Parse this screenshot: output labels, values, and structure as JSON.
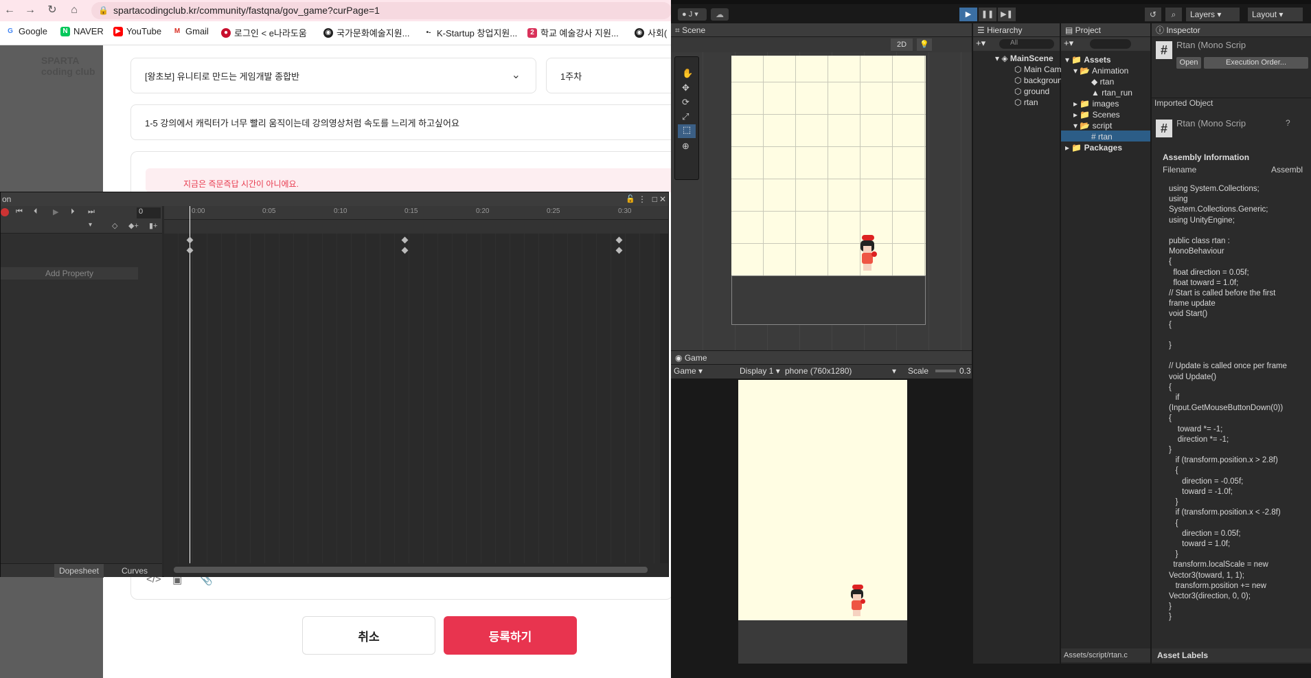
{
  "browser": {
    "url": "spartacodingclub.kr/community/fastqna/gov_game?curPage=1",
    "bookmarks": [
      "Google",
      "NAVER",
      "YouTube",
      "Gmail",
      "로그인 < e나라도움",
      "국가문화예술지원...",
      "K-Startup 창업지원...",
      "학교 예술강사 지원...",
      "사회("
    ]
  },
  "page": {
    "logo": "SPARTA coding club",
    "course_select": "[왕초보] 유니티로 만드는 게임개발 종합반",
    "week_select": "1주차",
    "question_title": "1-5 강의에서 캐릭터가 너무 빨리 움직이는데 강의영상처럼 속도를 느리게 하고싶어요",
    "warning": "지금은 즉문즉답 시간이 아니에요.",
    "cancel_label": "취소",
    "submit_label": "등록하기"
  },
  "animation": {
    "title": "on",
    "frame_value": "0",
    "add_property": "Add Property",
    "ticks": [
      "0:00",
      "0:05",
      "0:10",
      "0:15",
      "0:20",
      "0:25",
      "0:30"
    ],
    "tab_dopesheet": "Dopesheet",
    "tab_curves": "Curves"
  },
  "unity": {
    "account": "J",
    "layers": "Layers",
    "layout": "Layout",
    "scene_tab": "Scene",
    "mode_2d": "2D",
    "game_tab": "Game",
    "game_dropdown": "Game",
    "display": "Display 1",
    "resolution": "phone (760x1280)",
    "scale_label": "Scale",
    "scale_value": "0.3",
    "hierarchy_tab": "Hierarchy",
    "hierarchy_search": "All",
    "hierarchy": [
      "MainScene",
      "Main Camer",
      "background",
      "ground",
      "rtan"
    ],
    "project_tab": "Project",
    "project": {
      "assets": "Assets",
      "animation": "Animation",
      "anim_rtan": "rtan",
      "anim_rtan_run": "rtan_run",
      "images": "images",
      "scenes": "Scenes",
      "script": "script",
      "script_rtan": "rtan",
      "packages": "Packages"
    },
    "project_footer": "Assets/script/rtan.c",
    "inspector_tab": "Inspector",
    "inspector_title": "Rtan (Mono Scrip",
    "open_btn": "Open",
    "exec_btn": "Execution Order...",
    "imported_object": "Imported Object",
    "imported_title": "Rtan (Mono Scrip",
    "assembly_info": "Assembly Information",
    "filename": "Filename",
    "assembly": "Assembl",
    "code": "using System.Collections;\nusing\nSystem.Collections.Generic;\nusing UnityEngine;\n\npublic class rtan :\nMonoBehaviour\n{\n  float direction = 0.05f;\n  float toward = 1.0f;\n// Start is called before the first\nframe update\nvoid Start()\n{\n\n}\n\n// Update is called once per frame\nvoid Update()\n{\n   if\n(Input.GetMouseButtonDown(0))\n{\n    toward *= -1;\n    direction *= -1;\n}\n   if (transform.position.x > 2.8f)\n   {\n      direction = -0.05f;\n      toward = -1.0f;\n   }\n   if (transform.position.x < -2.8f)\n   {\n      direction = 0.05f;\n      toward = 1.0f;\n   }\n  transform.localScale = new\nVector3(toward, 1, 1);\n   transform.position += new\nVector3(direction, 0, 0);\n}\n}",
    "asset_labels": "Asset Labels"
  },
  "colors": {
    "accent": "#e8344f",
    "unity_bg": "#282828",
    "selection": "#2c5d87"
  }
}
